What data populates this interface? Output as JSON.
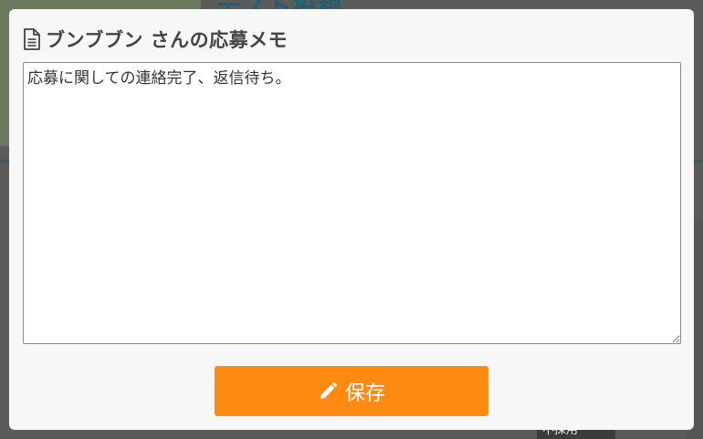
{
  "background": {
    "title_fragment": "テスト投稿",
    "bottom_box_text": "不採用"
  },
  "modal": {
    "title": "ブンブブン さんの応募メモ",
    "title_icon": "document-icon",
    "memo_text": "応募に関しての連絡完了、返信待ち。",
    "save_label": "保存",
    "save_icon": "pencil-icon",
    "accent_color": "#ff8a12"
  }
}
